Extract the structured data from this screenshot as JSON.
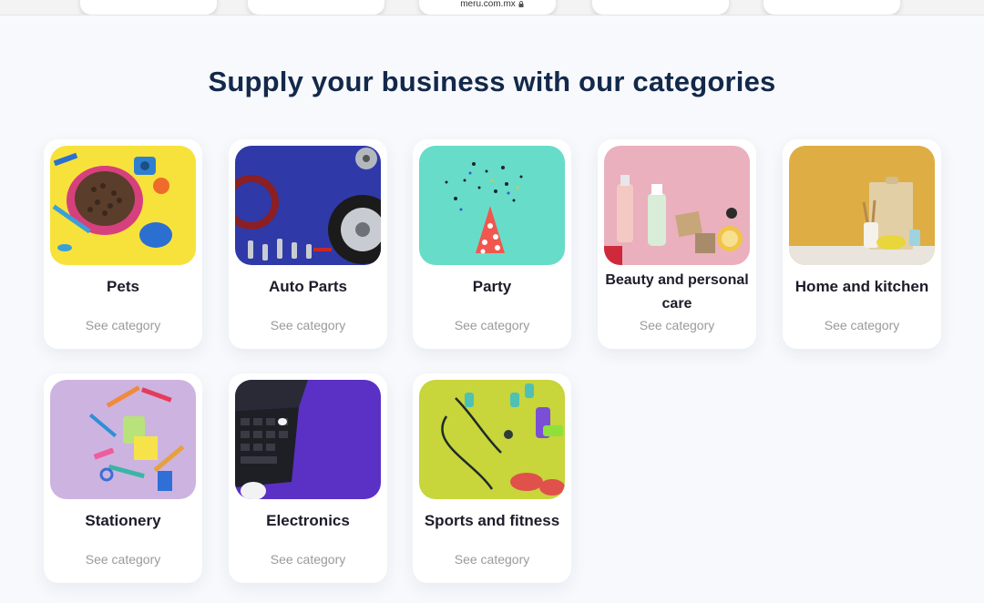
{
  "browser": {
    "url": "meru.com.mx"
  },
  "section": {
    "title": "Supply your business with our categories"
  },
  "categories": [
    {
      "name": "Pets",
      "link": "See category",
      "image": "pets-photo"
    },
    {
      "name": "Auto Parts",
      "link": "See category",
      "image": "auto-parts-photo"
    },
    {
      "name": "Party",
      "link": "See category",
      "image": "party-photo"
    },
    {
      "name": "Beauty and personal care",
      "link": "See category",
      "image": "beauty-photo"
    },
    {
      "name": "Home and kitchen",
      "link": "See category",
      "image": "home-kitchen-photo"
    },
    {
      "name": "Stationery",
      "link": "See category",
      "image": "stationery-photo"
    },
    {
      "name": "Electronics",
      "link": "See category",
      "image": "electronics-photo"
    },
    {
      "name": "Sports and fitness",
      "link": "See category",
      "image": "sports-photo"
    }
  ],
  "colors": {
    "heading": "#13294b",
    "background": "#f7f9fc",
    "link": "#9a9a9a"
  }
}
